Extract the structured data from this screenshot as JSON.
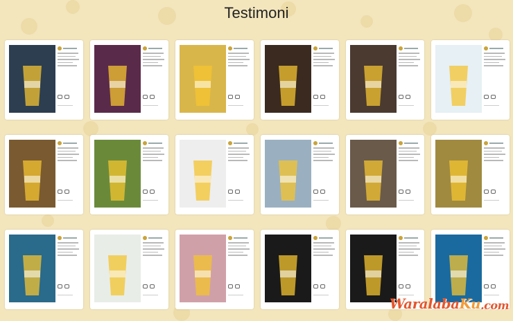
{
  "page": {
    "title": "Testimoni",
    "background_color": "#f3e6bd",
    "accent_color": "#f4c430"
  },
  "watermark": {
    "part1": "Waralaba",
    "part2": "Ku",
    "tld": ".com"
  },
  "cards": [
    {
      "photo": "gojek-promo-photo",
      "tone": "#2c3e50"
    },
    {
      "photo": "pink-drink-cup-photo",
      "tone": "#5a2a4a"
    },
    {
      "photo": "yellow-booth-photo",
      "tone": "#d9b64a"
    },
    {
      "photo": "two-drinks-table-photo",
      "tone": "#3a2a20"
    },
    {
      "photo": "hand-holding-cup-photo",
      "tone": "#4a3a30"
    },
    {
      "photo": "chat-screenshot-photo",
      "tone": "#e6f0f5"
    },
    {
      "photo": "mango-cup-photo",
      "tone": "#7a5a30"
    },
    {
      "photo": "two-boys-booth-photo",
      "tone": "#6a8a3a"
    },
    {
      "photo": "review-screenshot-photo",
      "tone": "#eeeeee"
    },
    {
      "photo": "drink-promo-photo",
      "tone": "#9ab0c0"
    },
    {
      "photo": "women-group-photo",
      "tone": "#6a5a4a"
    },
    {
      "photo": "orange-cup-photo",
      "tone": "#a08a40"
    },
    {
      "photo": "outdoor-booth-photo",
      "tone": "#2a6a8a"
    },
    {
      "photo": "whatsapp-chat-photo",
      "tone": "#e8ede8"
    },
    {
      "photo": "pink-cups-photo",
      "tone": "#d0a0a8"
    },
    {
      "photo": "four-drinks-photo",
      "tone": "#1a1a1a"
    },
    {
      "photo": "dark-drinks-photo",
      "tone": "#1a1a1a"
    },
    {
      "photo": "beach-promo-photo",
      "tone": "#1a6aa0"
    }
  ]
}
